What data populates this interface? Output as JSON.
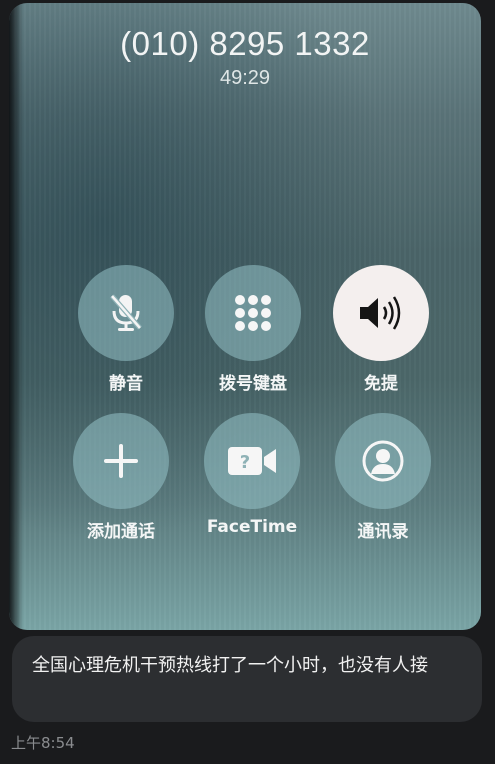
{
  "call_screen": {
    "phone_number": "(010) 8295 1332",
    "duration": "49:29",
    "controls": [
      {
        "id": "mute",
        "label": "静音",
        "icon": "mic-off-icon",
        "active": false
      },
      {
        "id": "keypad",
        "label": "拨号键盘",
        "icon": "keypad-icon",
        "active": false
      },
      {
        "id": "speaker",
        "label": "免提",
        "icon": "speaker-icon",
        "active": true
      },
      {
        "id": "add-call",
        "label": "添加通话",
        "icon": "plus-icon",
        "active": false
      },
      {
        "id": "facetime",
        "label": "FaceTime",
        "icon": "facetime-icon",
        "active": false
      },
      {
        "id": "contacts",
        "label": "通讯录",
        "icon": "contacts-icon",
        "active": false
      }
    ]
  },
  "message": {
    "text": "全国心理危机干预热线打了一个小时，也没有人接",
    "time": "上午8:54"
  },
  "colors": {
    "chat_background": "#1a1b1d",
    "bubble_background": "#2c2e31",
    "button_fill": "#96c3c8",
    "active_button_fill": "#f4efee",
    "timestamp_text": "#8a8c8f"
  }
}
